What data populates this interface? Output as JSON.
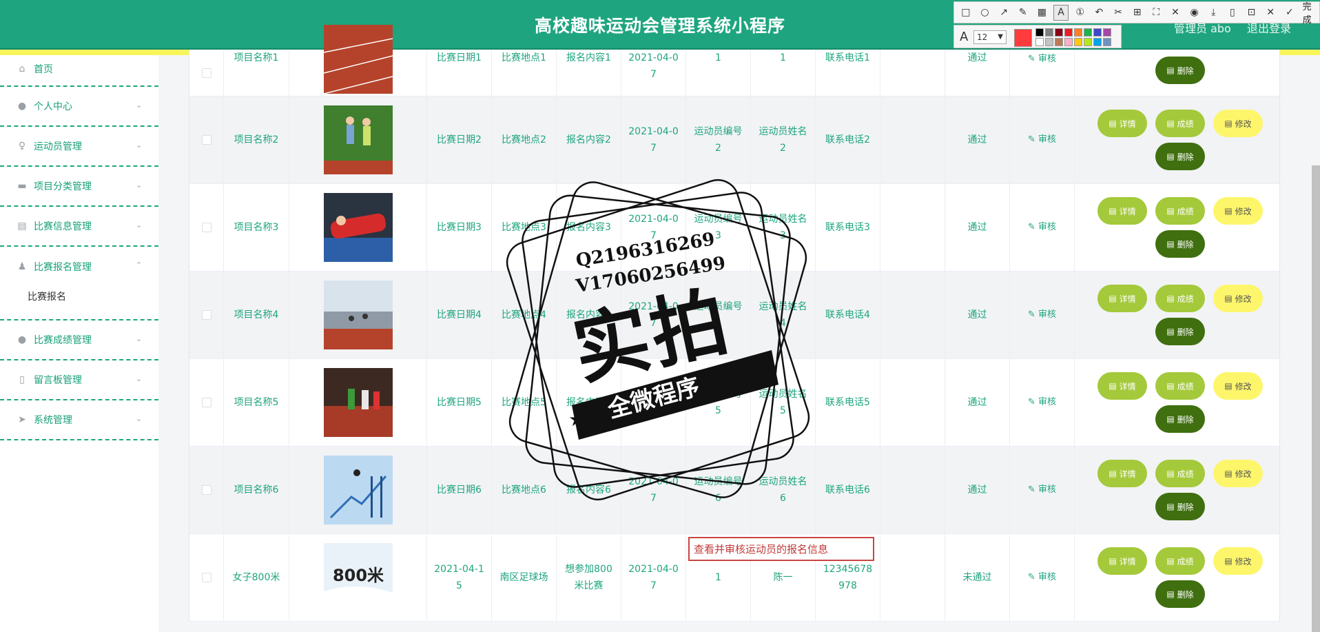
{
  "header": {
    "title": "高校趣味运动会管理系统小程序",
    "admin_label": "管理员 abo",
    "logout_label": "退出登录"
  },
  "snap_tool": {
    "tools": [
      "rect-icon",
      "ellipse-icon",
      "arrow-icon",
      "pen-icon",
      "mosaic-icon",
      "text-icon",
      "number-icon",
      "undo-icon",
      "redo-icon",
      "ocr-icon",
      "pin-icon",
      "pick-icon",
      "circle-record-icon",
      "save-icon",
      "phone-icon",
      "bookmark-icon",
      "close-icon",
      "check-icon"
    ],
    "done_label": "完成",
    "font_size": "12",
    "current_color": "#ff3b3b",
    "palette": [
      "#000000",
      "#7f7f7f",
      "#880015",
      "#ed1c24",
      "#ff7f27",
      "#22b14c",
      "#3f48cc",
      "#a349a4",
      "#ffffff",
      "#c3c3c3",
      "#b97a57",
      "#ffaec9",
      "#ffc90e",
      "#b5e61d",
      "#00a2e8",
      "#7092be"
    ]
  },
  "sidebar": {
    "items": [
      {
        "label": "首页",
        "icon": "home-icon"
      },
      {
        "label": "个人中心",
        "icon": "user-icon"
      },
      {
        "label": "运动员管理",
        "icon": "mic-icon"
      },
      {
        "label": "项目分类管理",
        "icon": "briefcase-icon"
      },
      {
        "label": "比赛信息管理",
        "icon": "clipboard-icon"
      },
      {
        "label": "比赛报名管理",
        "icon": "person-icon",
        "open": true,
        "sub": [
          "比赛报名"
        ]
      },
      {
        "label": "比赛成绩管理",
        "icon": "user-icon"
      },
      {
        "label": "留言板管理",
        "icon": "phone-icon"
      },
      {
        "label": "系统管理",
        "icon": "send-icon"
      }
    ]
  },
  "table": {
    "audit_label": "审核",
    "buttons": {
      "detail": "详情",
      "score": "成绩",
      "edit": "修改",
      "delete": "删除"
    },
    "rows": [
      {
        "name": "项目名称1",
        "date": "比赛日期1",
        "place": "比赛地点1",
        "content": "报名内容1",
        "signup_date": "2021-04-07",
        "athlete_no": "1",
        "athlete_name": "1",
        "phone": "联系电话1",
        "status": "通过",
        "img": "track"
      },
      {
        "name": "项目名称2",
        "date": "比赛日期2",
        "place": "比赛地点2",
        "content": "报名内容2",
        "signup_date": "2021-04-07",
        "athlete_no": "运动员编号2",
        "athlete_name": "运动员姓名2",
        "phone": "联系电话2",
        "status": "通过",
        "img": "runners"
      },
      {
        "name": "项目名称3",
        "date": "比赛日期3",
        "place": "比赛地点3",
        "content": "报名内容3",
        "signup_date": "2021-04-07",
        "athlete_no": "运动员编号3",
        "athlete_name": "运动员姓名3",
        "phone": "联系电话3",
        "status": "通过",
        "img": "highjump"
      },
      {
        "name": "项目名称4",
        "date": "比赛日期4",
        "place": "比赛地点4",
        "content": "报名内容4",
        "signup_date": "2021-04-07",
        "athlete_no": "运动员编号4",
        "athlete_name": "运动员姓名4",
        "phone": "联系电话4",
        "status": "通过",
        "img": "crowd"
      },
      {
        "name": "项目名称5",
        "date": "比赛日期5",
        "place": "比赛地点5",
        "content": "报名内容5",
        "signup_date": "2021-04-07",
        "athlete_no": "运动员编号5",
        "athlete_name": "运动员姓名5",
        "phone": "联系电话5",
        "status": "通过",
        "img": "race"
      },
      {
        "name": "项目名称6",
        "date": "比赛日期6",
        "place": "比赛地点6",
        "content": "报名内容6",
        "signup_date": "2021-04-07",
        "athlete_no": "运动员编号6",
        "athlete_name": "运动员姓名6",
        "phone": "联系电话6",
        "status": "通过",
        "img": "jump"
      },
      {
        "name": "女子800米",
        "date": "2021-04-15",
        "place": "南区足球场",
        "content": "想参加800米比赛",
        "signup_date": "2021-04-07",
        "athlete_no": "1",
        "athlete_name": "陈一",
        "phone": "12345678978",
        "status": "未通过",
        "img": "800m"
      }
    ]
  },
  "annotation": {
    "text": "查看并审核运动员的报名信息"
  },
  "watermark": {
    "line1": "Q2196316269",
    "line2": "V17060256499",
    "big": "实拍",
    "banner": "全微程序"
  }
}
